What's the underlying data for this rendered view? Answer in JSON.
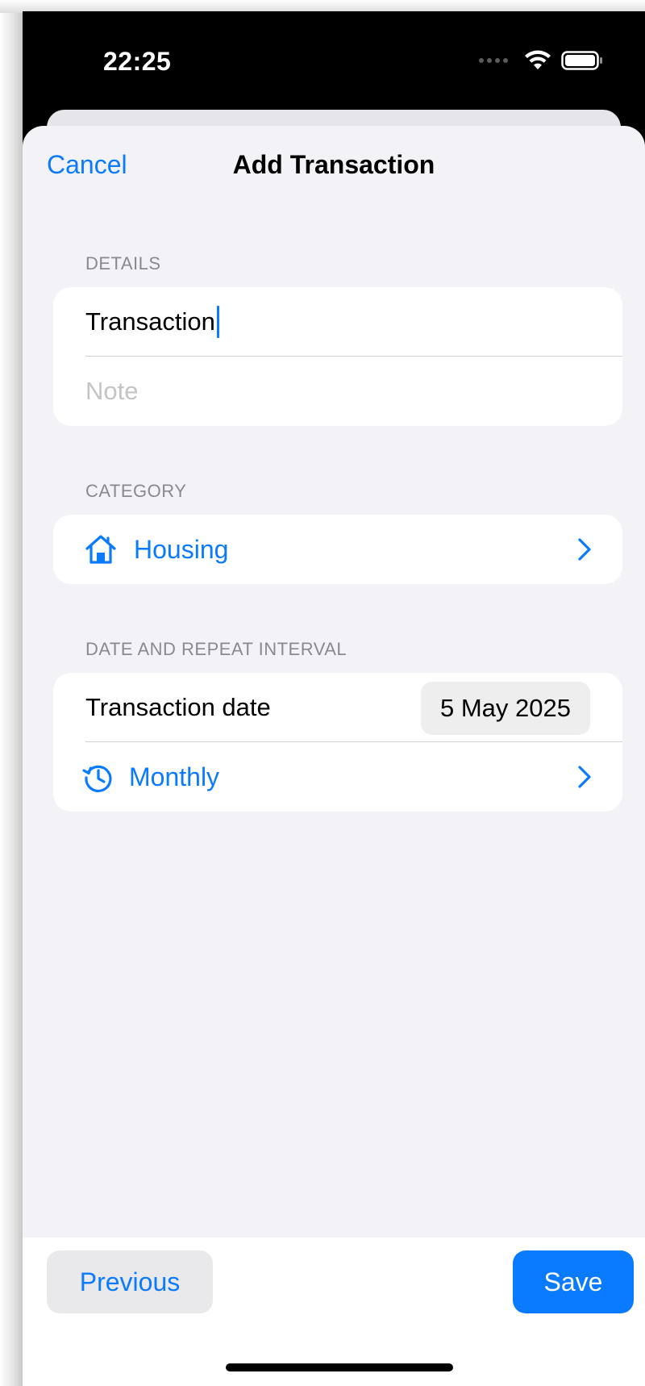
{
  "status_bar": {
    "time": "22:25"
  },
  "nav": {
    "cancel_label": "Cancel",
    "title": "Add Transaction"
  },
  "details": {
    "header": "DETAILS",
    "name_value": "Transaction",
    "note_placeholder": "Note"
  },
  "category": {
    "header": "CATEGORY",
    "selected": "Housing",
    "icon": "house-icon"
  },
  "date_repeat": {
    "header": "DATE AND REPEAT INTERVAL",
    "date_label": "Transaction date",
    "date_value": "5 May 2025",
    "repeat_value": "Monthly",
    "repeat_icon": "clock-history-icon"
  },
  "toolbar": {
    "previous_label": "Previous",
    "save_label": "Save"
  },
  "colors": {
    "accent": "#0a7aff",
    "background": "#f2f2f7",
    "card": "#ffffff"
  }
}
